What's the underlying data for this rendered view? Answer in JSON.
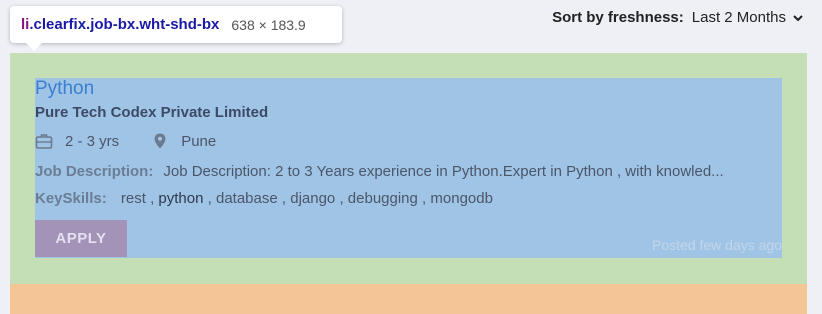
{
  "inspector": {
    "tag": "li",
    "class_selector": ".clearfix.job-bx.wht-shd-bx",
    "size": "638 × 183.9"
  },
  "sort": {
    "label": "Sort by freshness:",
    "value": "Last 2 Months"
  },
  "job": {
    "title": "Python",
    "company": "Pure Tech Codex Private Limited",
    "experience": "2 - 3 yrs",
    "location": "Pune",
    "description_label": "Job Description:",
    "description": "Job Description: 2 to 3 Years experience in Python.Expert in Python , with knowled...",
    "skills_label": "KeySkills:",
    "skills": [
      "rest",
      "python",
      "database",
      "django",
      "debugging",
      "mongodb"
    ],
    "apply_label": "APPLY",
    "posted": "Posted few days ago"
  }
}
